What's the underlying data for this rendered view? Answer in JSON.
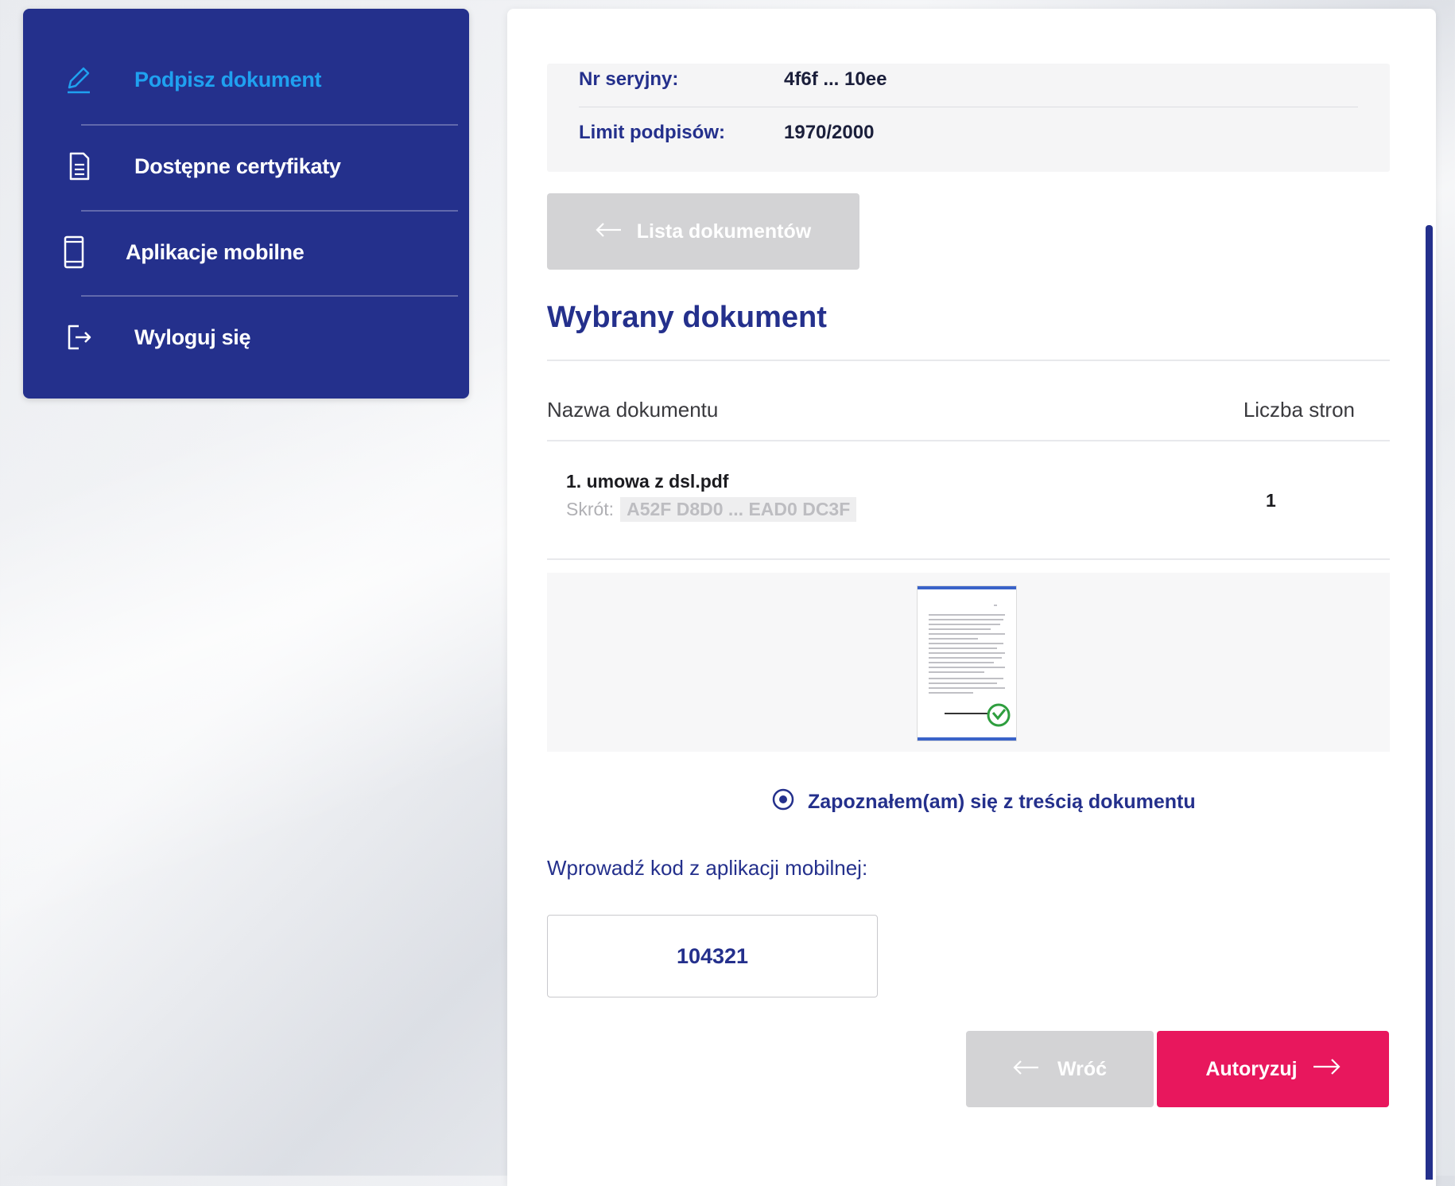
{
  "sidebar": {
    "items": [
      {
        "label": "Podpisz dokument",
        "icon": "pen-icon",
        "active": true
      },
      {
        "label": "Dostępne certyfikaty",
        "icon": "certificate-icon",
        "active": false
      },
      {
        "label": "Aplikacje mobilne",
        "icon": "mobile-phone-icon",
        "active": false
      },
      {
        "label": "Wyloguj się",
        "icon": "logout-icon",
        "active": false
      }
    ]
  },
  "certificate": {
    "serial_label": "Nr seryjny:",
    "serial_value": "4f6f ... 10ee",
    "limit_label": "Limit podpisów:",
    "limit_value": "1970/2000"
  },
  "doc_list_button": "Lista dokumentów",
  "section_title": "Wybrany dokument",
  "table": {
    "col_name": "Nazwa dokumentu",
    "col_pages": "Liczba stron",
    "rows": [
      {
        "name": "1. umowa z dsl.pdf",
        "hash_label": "Skrót:",
        "hash_value": "A52F D8D0 ... EAD0 DC3F",
        "pages": "1"
      }
    ]
  },
  "acknowledge_label": "Zapoznałem(am) się z treścią dokumentu",
  "code": {
    "label": "Wprowadź kod z aplikacji mobilnej:",
    "value": "104321"
  },
  "buttons": {
    "back": "Wróć",
    "authorize": "Autoryzuj"
  },
  "colors": {
    "navy": "#24308c",
    "active_blue": "#1fa1f0",
    "accent_pink": "#e8175d",
    "disabled_gray": "#d3d3d5",
    "check_green": "#2e9e3e"
  }
}
